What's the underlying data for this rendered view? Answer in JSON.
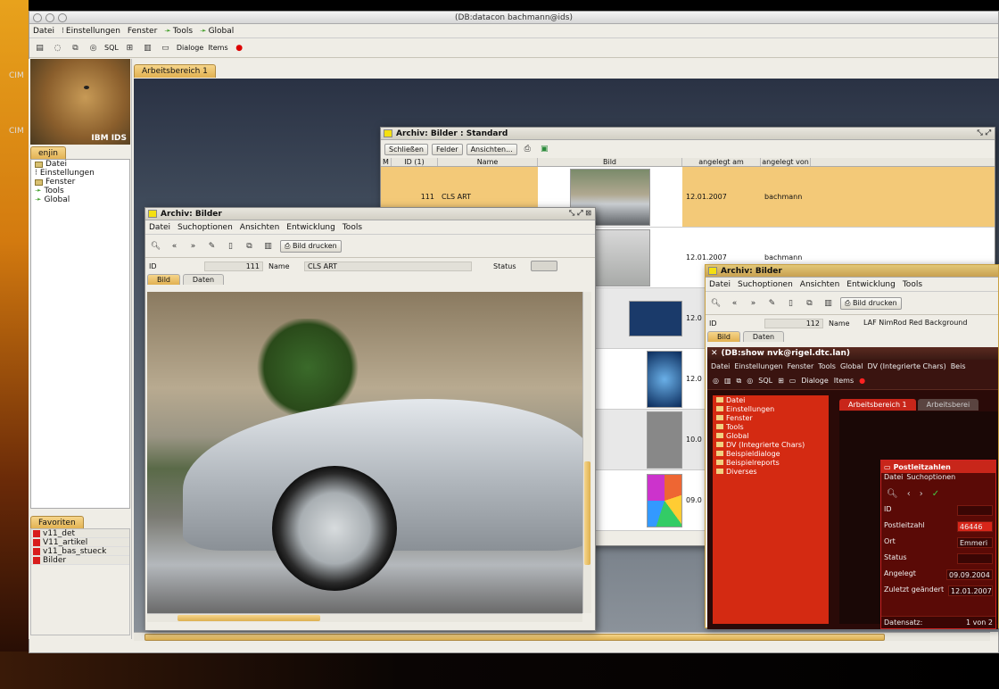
{
  "desktop": {
    "side_labels": [
      "CIM",
      "CIM"
    ]
  },
  "main_window": {
    "title": "(DB:datacon bachmann@ids)",
    "menu": [
      "Datei",
      "Einstellungen",
      "Fenster",
      "Tools",
      "Global"
    ],
    "toolbar": {
      "sql": "SQL",
      "dialoge": "Dialoge",
      "items": "Items"
    },
    "workspace_tab": "Arbeitsbereich 1"
  },
  "left_panel": {
    "logo_text": "IBM IDS",
    "tree_tab": "enjin",
    "tree_items": [
      "Datei",
      "Einstellungen",
      "Fenster",
      "Tools",
      "Global"
    ],
    "favorites_tab": "Favoriten",
    "favorites": [
      "v11_det",
      "V11_artikel",
      "v11_bas_stueck",
      "Bilder"
    ]
  },
  "archive_standard": {
    "title": "Archiv: Bilder : Standard",
    "buttons": [
      "Schließen",
      "Felder",
      "Ansichten..."
    ],
    "columns": [
      "M",
      "ID (1)",
      "Name",
      "Bild",
      "angelegt am",
      "angelegt von"
    ],
    "rows": [
      {
        "id": "111",
        "name": "CLS ART",
        "date": "12.01.2007",
        "user": "bachmann"
      },
      {
        "id": "",
        "name": "",
        "date": "12.01.2007",
        "user": "bachmann"
      },
      {
        "id": "",
        "name": "",
        "date": "12.0",
        "user": ""
      },
      {
        "id": "",
        "name": "",
        "date": "12.0",
        "user": ""
      },
      {
        "id": "",
        "name": "",
        "date": "10.0",
        "user": ""
      },
      {
        "id": "",
        "name": "",
        "date": "09.0",
        "user": ""
      }
    ]
  },
  "archive_detail_1": {
    "title": "Archiv: Bilder",
    "menu": [
      "Datei",
      "Suchoptionen",
      "Ansichten",
      "Entwicklung",
      "Tools"
    ],
    "print_button": "Bild drucken",
    "id_label": "ID",
    "id_value": "111",
    "name_label": "Name",
    "name_value": "CLS ART",
    "status_label": "Status",
    "tabs": [
      "Bild",
      "Daten"
    ]
  },
  "archive_detail_2": {
    "title": "Archiv: Bilder",
    "menu": [
      "Datei",
      "Suchoptionen",
      "Ansichten",
      "Entwicklung",
      "Tools"
    ],
    "print_button": "Bild drucken",
    "id_label": "ID",
    "id_value": "112",
    "name_label": "Name",
    "name_value": "LAF NimRod Red Background",
    "tabs": [
      "Bild",
      "Daten"
    ]
  },
  "nested_app": {
    "title": "(DB:show nvk@rigel.dtc.lan)",
    "menu": [
      "Datei",
      "Einstellungen",
      "Fenster",
      "Tools",
      "Global",
      "DV (Integrierte Chars)",
      "Beis"
    ],
    "toolbar": {
      "sql": "SQL",
      "dialoge": "Dialoge",
      "items": "Items"
    },
    "tree": [
      "Datei",
      "Einstellungen",
      "Fenster",
      "Tools",
      "Global",
      "DV (Integrierte Chars)",
      "Beispieldialoge",
      "Beispielreports",
      "Diverses"
    ],
    "tabs": [
      "Arbeitsbereich 1",
      "Arbeitsberei"
    ]
  },
  "postleitzahlen": {
    "title": "Postleitzahlen",
    "menu": [
      "Datei",
      "Suchoptionen"
    ],
    "fields": [
      {
        "label": "ID",
        "value": ""
      },
      {
        "label": "Postleitzahl",
        "value": "46446"
      },
      {
        "label": "Ort",
        "value": "Emmeri"
      },
      {
        "label": "Status",
        "value": ""
      },
      {
        "label": "Angelegt",
        "value": "09.09.2004"
      },
      {
        "label": "Zuletzt geändert",
        "value": "12.01.2007"
      }
    ],
    "record_label": "Datensatz:",
    "record_value": "1 von 2"
  }
}
